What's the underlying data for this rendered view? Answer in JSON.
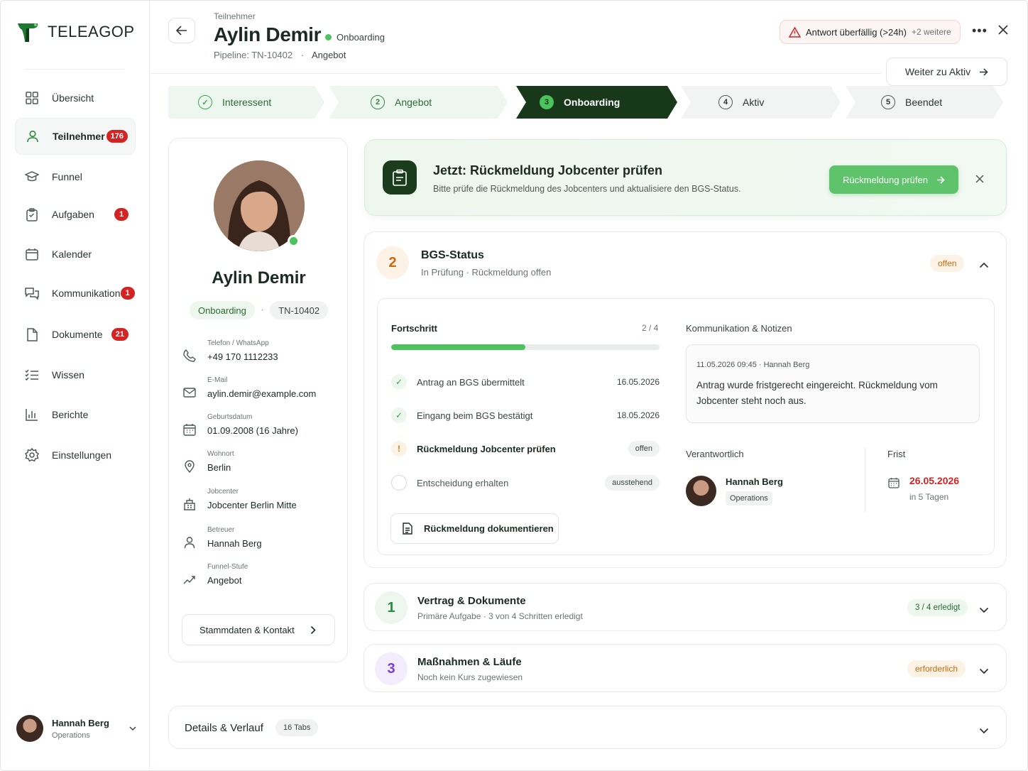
{
  "app": {
    "logo_text": "TELEAGOP"
  },
  "sidebar": {
    "items": [
      {
        "label": "Übersicht",
        "icon": "dashboard-icon",
        "badge": ""
      },
      {
        "label": "Teilnehmer",
        "icon": "user-icon",
        "badge": "176"
      },
      {
        "label": "Funnel",
        "icon": "graduation-cap-icon",
        "badge": ""
      },
      {
        "label": "Aufgaben",
        "icon": "clipboard-icon",
        "badge": "1"
      },
      {
        "label": "Kalender",
        "icon": "calendar-icon",
        "badge": ""
      },
      {
        "label": "Kommunikation",
        "icon": "chat-icon",
        "badge": "1"
      },
      {
        "label": "Dokumente",
        "icon": "document-icon",
        "badge": "21"
      },
      {
        "label": "Wissen",
        "icon": "list-check-icon",
        "badge": ""
      },
      {
        "label": "Berichte",
        "icon": "bar-chart-icon",
        "badge": ""
      },
      {
        "label": "Einstellungen",
        "icon": "gear-icon",
        "badge": ""
      }
    ],
    "active_index": 1,
    "user": {
      "name": "Hannah Berg",
      "role": "Operations"
    }
  },
  "header": {
    "kicker": "Teilnehmer",
    "title": "Aylin Demir",
    "status": "Onboarding",
    "pipeline_label": "Pipeline: TN-10402",
    "stage": "Angebot",
    "alert": "Antwort überfällig (>24h)",
    "alert_more": "+2 weitere",
    "next_button": "Weiter zu Aktiv"
  },
  "stepper": [
    {
      "num": "✓",
      "label": "Interessent",
      "state": "done"
    },
    {
      "num": "2",
      "label": "Angebot",
      "state": "done"
    },
    {
      "num": "3",
      "label": "Onboarding",
      "state": "active"
    },
    {
      "num": "4",
      "label": "Aktiv",
      "state": "todo"
    },
    {
      "num": "5",
      "label": "Beendet",
      "state": "todo"
    }
  ],
  "profile": {
    "name": "Aylin Demir",
    "tag_status": "Onboarding",
    "tag_id": "TN-10402",
    "fields": [
      {
        "label": "Telefon / WhatsApp",
        "value": "+49 170 1112233",
        "icon": "phone-icon"
      },
      {
        "label": "E-Mail",
        "value": "aylin.demir@example.com",
        "icon": "mail-icon"
      },
      {
        "label": "Geburtsdatum",
        "value": "01.09.2008 (16 Jahre)",
        "icon": "calendar-icon"
      },
      {
        "label": "Wohnort",
        "value": "Berlin",
        "icon": "location-pin-icon"
      },
      {
        "label": "Jobcenter",
        "value": "Jobcenter Berlin Mitte",
        "icon": "building-icon"
      },
      {
        "label": "Betreuer",
        "value": "Hannah Berg",
        "icon": "person-icon"
      },
      {
        "label": "Funnel-Stufe",
        "value": "Angebot",
        "icon": "trend-icon"
      }
    ],
    "button": "Stammdaten & Kontakt"
  },
  "banner": {
    "title": "Jetzt: Rückmeldung Jobcenter prüfen",
    "subtitle": "Bitte prüfe die Rückmeldung des Jobcenters und aktualisiere den BGS-Status.",
    "button": "Rückmeldung prüfen"
  },
  "bgs": {
    "num": "2",
    "title": "BGS-Status",
    "subtitle": "In Prüfung · Rückmeldung offen",
    "pill": "offen",
    "progress_title": "Fortschritt",
    "progress_count": "2 / 4",
    "progress_fraction": 0.5,
    "tasks": [
      {
        "label": "Antrag an BGS übermittelt",
        "meta": "16.05.2026",
        "state": "done"
      },
      {
        "label": "Eingang beim BGS bestätigt",
        "meta": "18.05.2026",
        "state": "done"
      },
      {
        "label": "Rückmeldung Jobcenter prüfen",
        "meta": "offen",
        "state": "warn"
      },
      {
        "label": "Entscheidung erhalten",
        "meta": "ausstehend",
        "state": "pending"
      }
    ],
    "doc_button": "Rückmeldung dokumentieren",
    "notes_title": "Kommunikation & Notizen",
    "note_meta": "11.05.2026 09:45 · Hannah Berg",
    "note_text": "Antrag wurde fristgerecht eingereicht. Rückmeldung vom Jobcenter steht noch aus.",
    "responsible_label": "Verantwortlich",
    "responsible_name": "Hannah Berg",
    "responsible_role": "Operations",
    "deadline_label": "Frist",
    "deadline_date": "26.05.2026",
    "deadline_in": "in 5 Tagen"
  },
  "sections": [
    {
      "num": "1",
      "title": "Vertrag & Dokumente",
      "subtitle": "Primäre Aufgabe · 3 von 4 Schritten erledigt",
      "pill": "3 / 4 erledigt",
      "color": "#2e8a3e"
    },
    {
      "num": "3",
      "title": "Maßnahmen & Läufe",
      "subtitle": "Noch kein Kurs zugewiesen",
      "pill": "erforderlich",
      "color": "#7a3fd6"
    }
  ],
  "details": {
    "title": "Details & Verlauf",
    "badge": "16 Tabs"
  },
  "colors": {
    "brand_dark": "#17391a",
    "accent_green": "#4cc35c",
    "alert_red": "#d42323",
    "warn_orange": "#c76a12"
  }
}
